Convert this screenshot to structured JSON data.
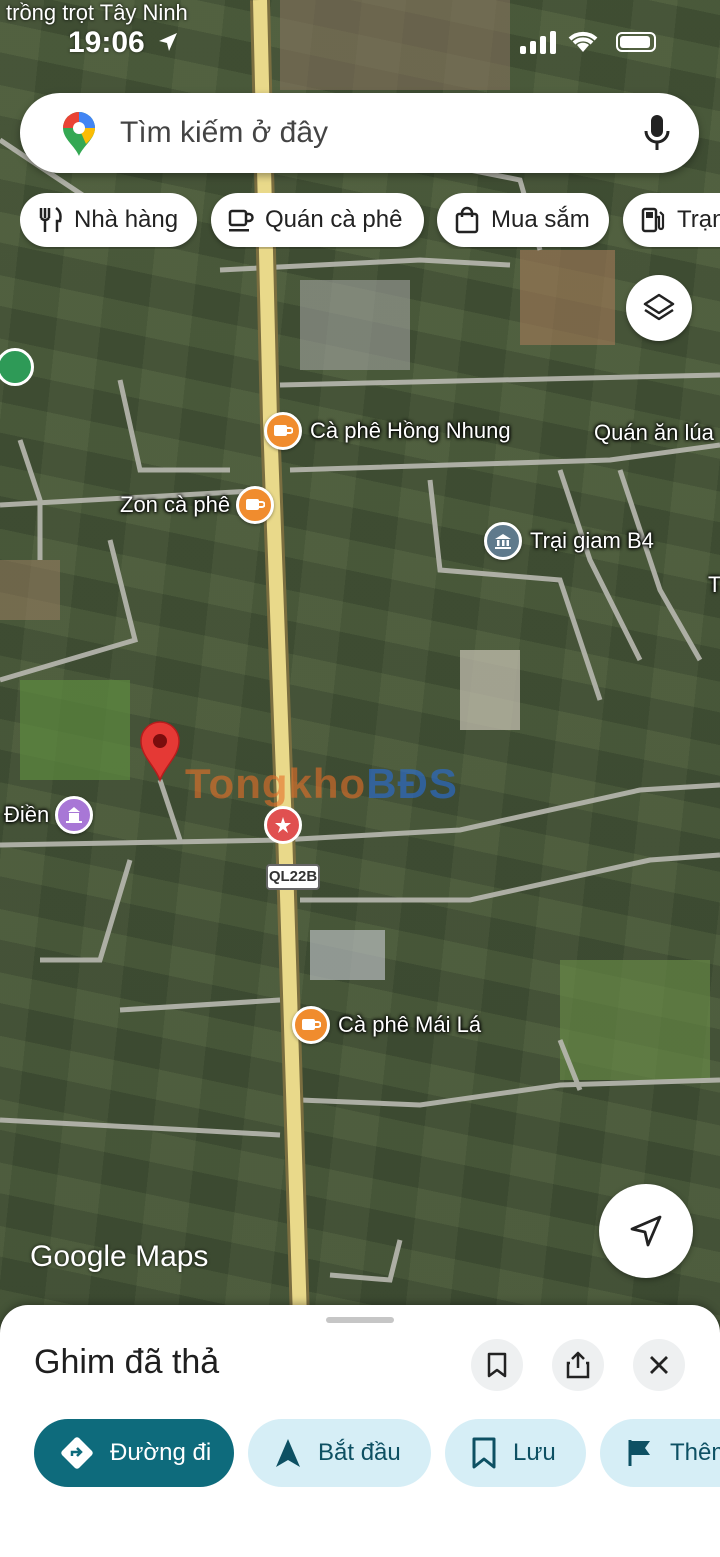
{
  "status_bar": {
    "top_label": "trồng trọt Tây Ninh",
    "time": "19:06"
  },
  "search": {
    "placeholder": "Tìm kiếm ở đây"
  },
  "chips": [
    {
      "label": "Nhà hàng",
      "icon": "fork-knife-icon"
    },
    {
      "label": "Quán cà phê",
      "icon": "coffee-cup-icon"
    },
    {
      "label": "Mua sắm",
      "icon": "shopping-bag-icon"
    },
    {
      "label": "Trạm",
      "icon": "fuel-pump-icon"
    }
  ],
  "map": {
    "places": [
      {
        "name": "Cà phê Hồng Nhung",
        "icon": "coffee-icon",
        "color": "#f08c2e"
      },
      {
        "name": "Quán ăn lúa",
        "icon": "none",
        "color": "#ffffff"
      },
      {
        "name": "Zon cà phê",
        "icon": "coffee-icon",
        "color": "#f08c2e"
      },
      {
        "name": "Trại giam B4",
        "icon": "government-building-icon",
        "color": "#5f7a8c"
      },
      {
        "name": "Điền",
        "icon": "temple-icon",
        "color": "#a877d6"
      },
      {
        "name": "Cà phê Mái Lá",
        "icon": "coffee-icon",
        "color": "#f08c2e"
      },
      {
        "name": "T",
        "icon": "none",
        "color": "#ffffff"
      }
    ],
    "road_shield": "QL22B",
    "watermark": {
      "part1": "Tongkho",
      "part2": "BĐS"
    },
    "attribution": "Google Maps",
    "dropped_pin_color": "#e53935",
    "road_color": "#e9d98a"
  },
  "sheet": {
    "title": "Ghim đã thả",
    "actions": [
      {
        "label": "Đường đi",
        "icon": "directions-icon"
      },
      {
        "label": "Bắt đầu",
        "icon": "navigation-arrow-icon"
      },
      {
        "label": "Lưu",
        "icon": "bookmark-icon"
      },
      {
        "label": "Thêm",
        "icon": "flag-icon"
      }
    ]
  }
}
